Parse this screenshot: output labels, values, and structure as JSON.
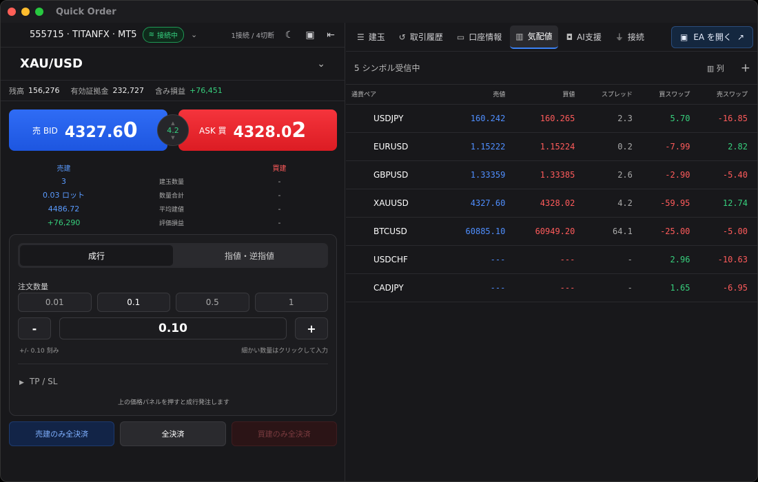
{
  "window": {
    "title": "Quick Order"
  },
  "account": {
    "label": "555715 · TITANFX · MT5",
    "status": "接続中",
    "connections": "1接続 / 4切断"
  },
  "symbol": {
    "name": "XAU/USD"
  },
  "balance": {
    "balance_label": "残高",
    "balance": "156,276",
    "margin_label": "有効証拠金",
    "margin": "232,727",
    "pnl_label": "含み損益",
    "pnl": "+76,451"
  },
  "bid": {
    "label": "売 BID",
    "price_main": "4327.6",
    "price_big": "0"
  },
  "ask": {
    "label": "ASK 買",
    "price_main": "4328.0",
    "price_big": "2"
  },
  "spread": "4.2",
  "positions": {
    "sell_header": "売建",
    "buy_header": "買建",
    "rows": [
      {
        "sell": "3",
        "label": "建玉数量",
        "buy": "-"
      },
      {
        "sell": "0.03 ロット",
        "label": "数量合計",
        "buy": "-"
      },
      {
        "sell": "4486.72",
        "label": "平均建値",
        "buy": "-"
      },
      {
        "sell": "+76,290",
        "label": "評価損益",
        "buy": "-"
      }
    ]
  },
  "order": {
    "tab_market": "成行",
    "tab_limit": "指値・逆指値",
    "qty_label": "注文数量",
    "presets": [
      "0.01",
      "0.1",
      "0.5",
      "1"
    ],
    "minus": "-",
    "value": "0.10",
    "plus": "+",
    "step_hint": "+/- 0.10 刻み",
    "fine_hint": "細かい数量はクリックして入力",
    "tpsl": "TP / SL",
    "note": "上の価格パネルを押すと成行発注します"
  },
  "close": {
    "sell_only": "売建のみ全決済",
    "all": "全決済",
    "buy_only": "買建のみ全決済"
  },
  "tabs": [
    {
      "icon": "list-icon",
      "label": "建玉"
    },
    {
      "icon": "history-icon",
      "label": "取引履歴"
    },
    {
      "icon": "wallet-icon",
      "label": "口座情報"
    },
    {
      "icon": "chart-icon",
      "label": "気配値"
    },
    {
      "icon": "ai-icon",
      "label": "AI支援"
    },
    {
      "icon": "plug-icon",
      "label": "接続"
    }
  ],
  "ea_button": "EA を開く",
  "quotes": {
    "status": "5 シンボル受信中",
    "columns_label": "列",
    "headers": [
      "通貨ペア",
      "売値",
      "買値",
      "スプレッド",
      "買スワップ",
      "売スワップ"
    ],
    "rows": [
      {
        "pair": "USDJPY",
        "bid": "160.242",
        "ask": "160.265",
        "spread": "2.3",
        "buy_swap": "5.70",
        "sell_swap": "-16.85"
      },
      {
        "pair": "EURUSD",
        "bid": "1.15222",
        "ask": "1.15224",
        "spread": "0.2",
        "buy_swap": "-7.99",
        "sell_swap": "2.82"
      },
      {
        "pair": "GBPUSD",
        "bid": "1.33359",
        "ask": "1.33385",
        "spread": "2.6",
        "buy_swap": "-2.90",
        "sell_swap": "-5.40"
      },
      {
        "pair": "XAUUSD",
        "bid": "4327.60",
        "ask": "4328.02",
        "spread": "4.2",
        "buy_swap": "-59.95",
        "sell_swap": "12.74"
      },
      {
        "pair": "BTCUSD",
        "bid": "60885.10",
        "ask": "60949.20",
        "spread": "64.1",
        "buy_swap": "-25.00",
        "sell_swap": "-5.00"
      },
      {
        "pair": "USDCHF",
        "bid": "---",
        "ask": "---",
        "spread": "-",
        "buy_swap": "2.96",
        "sell_swap": "-10.63"
      },
      {
        "pair": "CADJPY",
        "bid": "---",
        "ask": "---",
        "spread": "-",
        "buy_swap": "1.65",
        "sell_swap": "-6.95"
      }
    ]
  }
}
